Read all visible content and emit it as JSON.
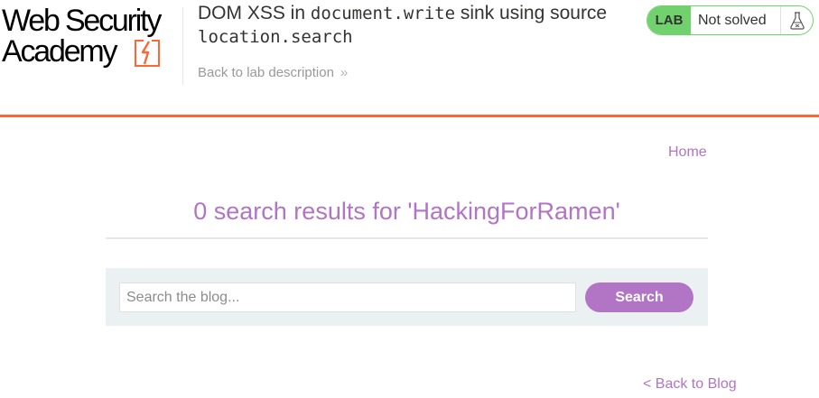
{
  "header": {
    "logo": {
      "line1": "Web Security",
      "line2": "Academy",
      "icon": "lightning-bolt-icon"
    },
    "lab_title": {
      "prefix": "DOM XSS in ",
      "code1": "document.write",
      "mid": " sink using source ",
      "code2": "location.search"
    },
    "back_to_description": "Back to lab description",
    "back_chevron": "»",
    "status": {
      "badge": "LAB",
      "text": "Not solved",
      "icon": "flask-icon"
    }
  },
  "nav": {
    "home": "Home"
  },
  "results": {
    "heading": "0 search results for 'HackingForRamen'"
  },
  "search": {
    "placeholder": "Search the blog...",
    "value": "",
    "button": "Search"
  },
  "footer": {
    "back_to_blog": "< Back to Blog"
  },
  "colors": {
    "accent": "#b274c5",
    "rule": "#ff6633",
    "status_green": "#70d16d",
    "panel": "#ebf0f2"
  }
}
